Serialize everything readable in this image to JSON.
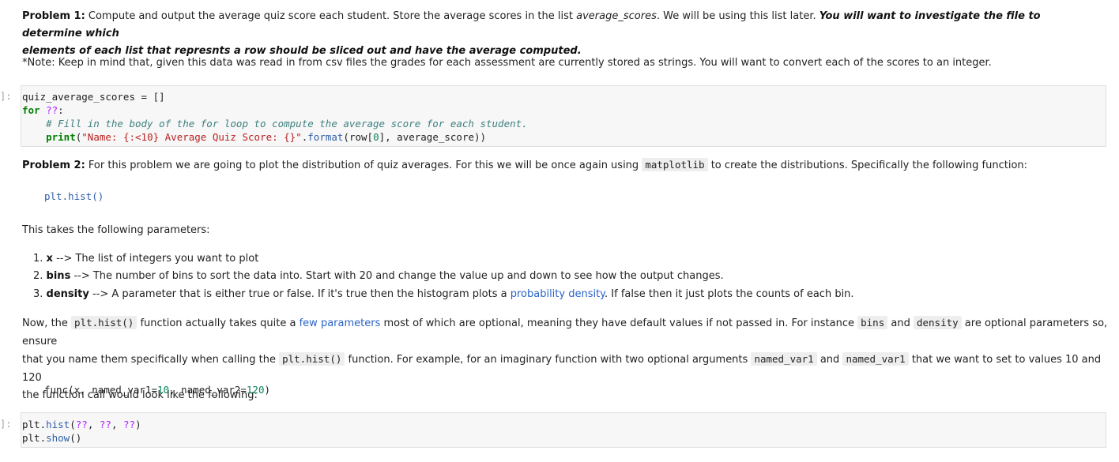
{
  "problem1": {
    "label": "Problem 1:",
    "text_a": "Compute and output the average quiz score each student. Store the average scores in the list ",
    "var": "average_scores",
    "text_b": ". We will be using this list later. ",
    "bold_italic": "You will want to investigate the file to determine which",
    "bold_italic_2": "elements of each list that represnts a row should be sliced out and have the average computed."
  },
  "note": "*Note: Keep in mind that, given this data was read in from csv files the grades for each assessment are currently stored as strings. You will want to convert each of the scores to an integer.",
  "cell1": {
    "prompt": "]:",
    "lines": [
      "quiz_average_scores = []",
      "for ??:",
      "    # Fill in the body of the for loop to compute the average score for each student.",
      "    print(\"Name: {:<10} Average Quiz Score: {}\".format(row[0], average_score))"
    ]
  },
  "problem2": {
    "label": "Problem 2:",
    "text_a": "For this problem we are going to plot the distribution of quiz averages. For this we will be once again using ",
    "code": "matplotlib",
    "text_b": " to create the distributions. Specifically the following function:"
  },
  "func_example": "plt.hist()",
  "params_intro": "This takes the following parameters:",
  "params": [
    {
      "num": "1.",
      "name": "x",
      "desc": " --> The list of integers you want to plot"
    },
    {
      "num": "2.",
      "name": "bins",
      "desc": " --> The number of bins to sort the data into. Start with 20 and change the value up and down to see how the output changes."
    },
    {
      "num": "3.",
      "name": "density",
      "desc": " --> A parameter that is either true or false. If it's true then the histogram plots a ",
      "link": "probability density",
      "desc_b": ". If false then it just plots the counts of each bin."
    }
  ],
  "para3": {
    "t1": "Now, the ",
    "c1": "plt.hist()",
    "t2": " function actually takes quite a ",
    "link": "few parameters",
    "t3": " most of which are optional, meaning they have default values if not passed in. For instance ",
    "c2": "bins",
    "t4": " and ",
    "c3": "density",
    "t5": " are optional parameters so, ensure",
    "line2_t1": "that you name them specifically when calling the ",
    "line2_c1": "plt.hist()",
    "line2_t2": " function. For example, for an imaginary function with two optional arguments ",
    "line2_c2": "named_var1",
    "line2_t3": " and ",
    "line2_c3": "named_var1",
    "line2_t4": " that we want to set to values 10 and 120",
    "line3": "the function call would look like the following:"
  },
  "func_call_example": "func(x, named_var1=10, named_var2=120)",
  "cell2": {
    "prompt": "]:",
    "lines": [
      "plt.hist(??, ??, ??)",
      "plt.show()"
    ]
  }
}
